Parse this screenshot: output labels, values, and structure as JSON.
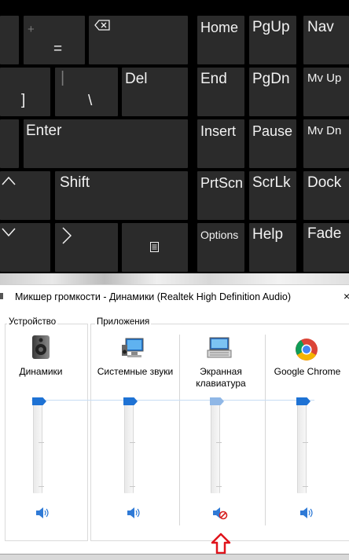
{
  "keyboard": {
    "keys": {
      "equals": {
        "label": "=",
        "shift": "+"
      },
      "backspace_icon": "backspace-icon",
      "home": "Home",
      "pgup": "PgUp",
      "nav": "Nav",
      "bracket": "]",
      "backslash": {
        "label": "\\",
        "shift": "|"
      },
      "del": "Del",
      "end": "End",
      "pgdn": "PgDn",
      "mvup": "Mv Up",
      "enter": "Enter",
      "insert": "Insert",
      "pause": "Pause",
      "mvdn": "Mv Dn",
      "shift": "Shift",
      "prtscn": "PrtScn",
      "scrlk": "ScrLk",
      "dock": "Dock",
      "options": "Options",
      "help": "Help",
      "fade": "Fade"
    }
  },
  "mixer": {
    "title": "Микшер громкости - Динамики (Realtek High Definition Audio)",
    "close_label": "×",
    "device_group_label": "Устройство",
    "apps_group_label": "Приложения",
    "channels": [
      {
        "name": "Динамики",
        "icon": "speaker-icon",
        "level": 1.0,
        "muted": false
      },
      {
        "name": "Системные звуки",
        "icon": "system-sounds-icon",
        "level": 1.0,
        "muted": false
      },
      {
        "name": "Экранная клавиатура",
        "icon": "onscreen-keyboard-icon",
        "level": 1.0,
        "muted": true
      },
      {
        "name": "Google Chrome",
        "icon": "chrome-icon",
        "level": 1.0,
        "muted": false
      }
    ]
  },
  "colors": {
    "key_bg": "#2b2b2b",
    "key_text": "#f2f2f2",
    "slider_thumb": "#1e72d4",
    "annotation_arrow": "#e0141c"
  }
}
